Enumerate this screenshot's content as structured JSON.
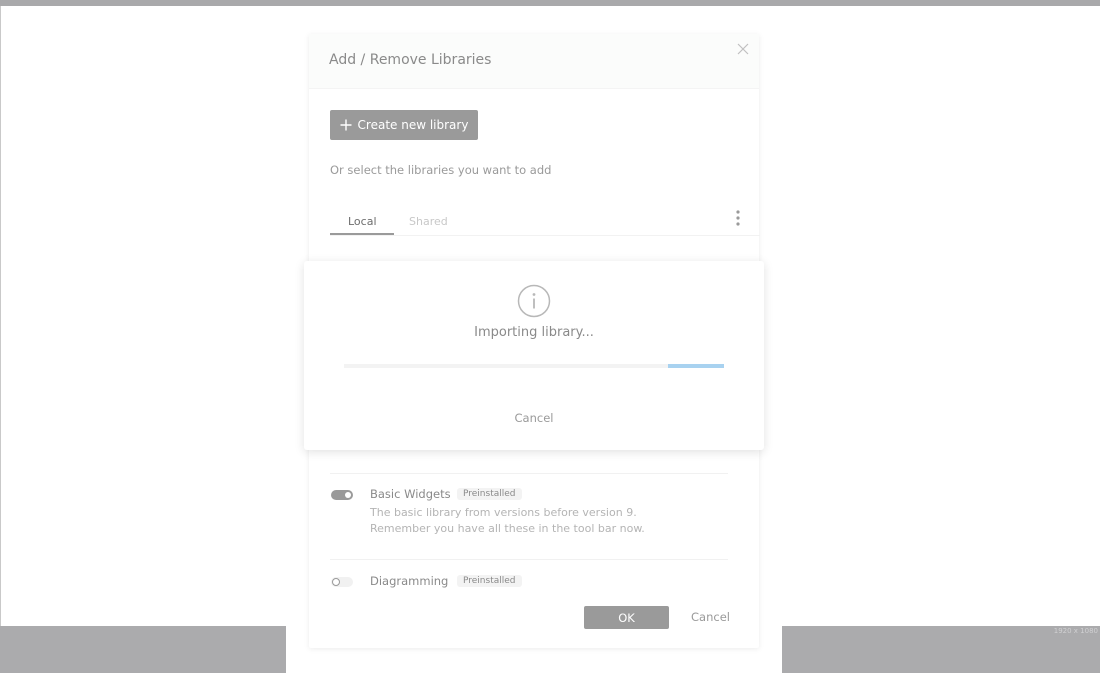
{
  "screen": {
    "resolution_label": "1920 x 1080"
  },
  "dialog": {
    "title": "Add / Remove Libraries",
    "close_icon": "close-icon",
    "create_button_label": "Create new library",
    "create_button_icon": "plus-icon",
    "select_hint": "Or select the libraries you want to add",
    "tabs": [
      {
        "label": "Local",
        "active": true
      },
      {
        "label": "Shared",
        "active": false
      }
    ],
    "more_icon": "vertical-dots-icon",
    "libraries": [
      {
        "name": "Basic Widgets",
        "badge": "Preinstalled",
        "enabled": true,
        "description_line1": "The basic library from versions before version 9.",
        "description_line2": "Remember you have all these in the tool bar now."
      },
      {
        "name": "Diagramming",
        "badge": "Preinstalled",
        "enabled": false
      }
    ],
    "ok_label": "OK",
    "cancel_label": "Cancel"
  },
  "import_overlay": {
    "icon": "info-icon",
    "title": "Importing library...",
    "cancel_label": "Cancel",
    "progress": {
      "start_fraction": 0.853,
      "end_fraction": 1.0
    }
  },
  "colors": {
    "accent_gray": "#9a9a9a",
    "progress_blue": "#a8d2f0"
  }
}
